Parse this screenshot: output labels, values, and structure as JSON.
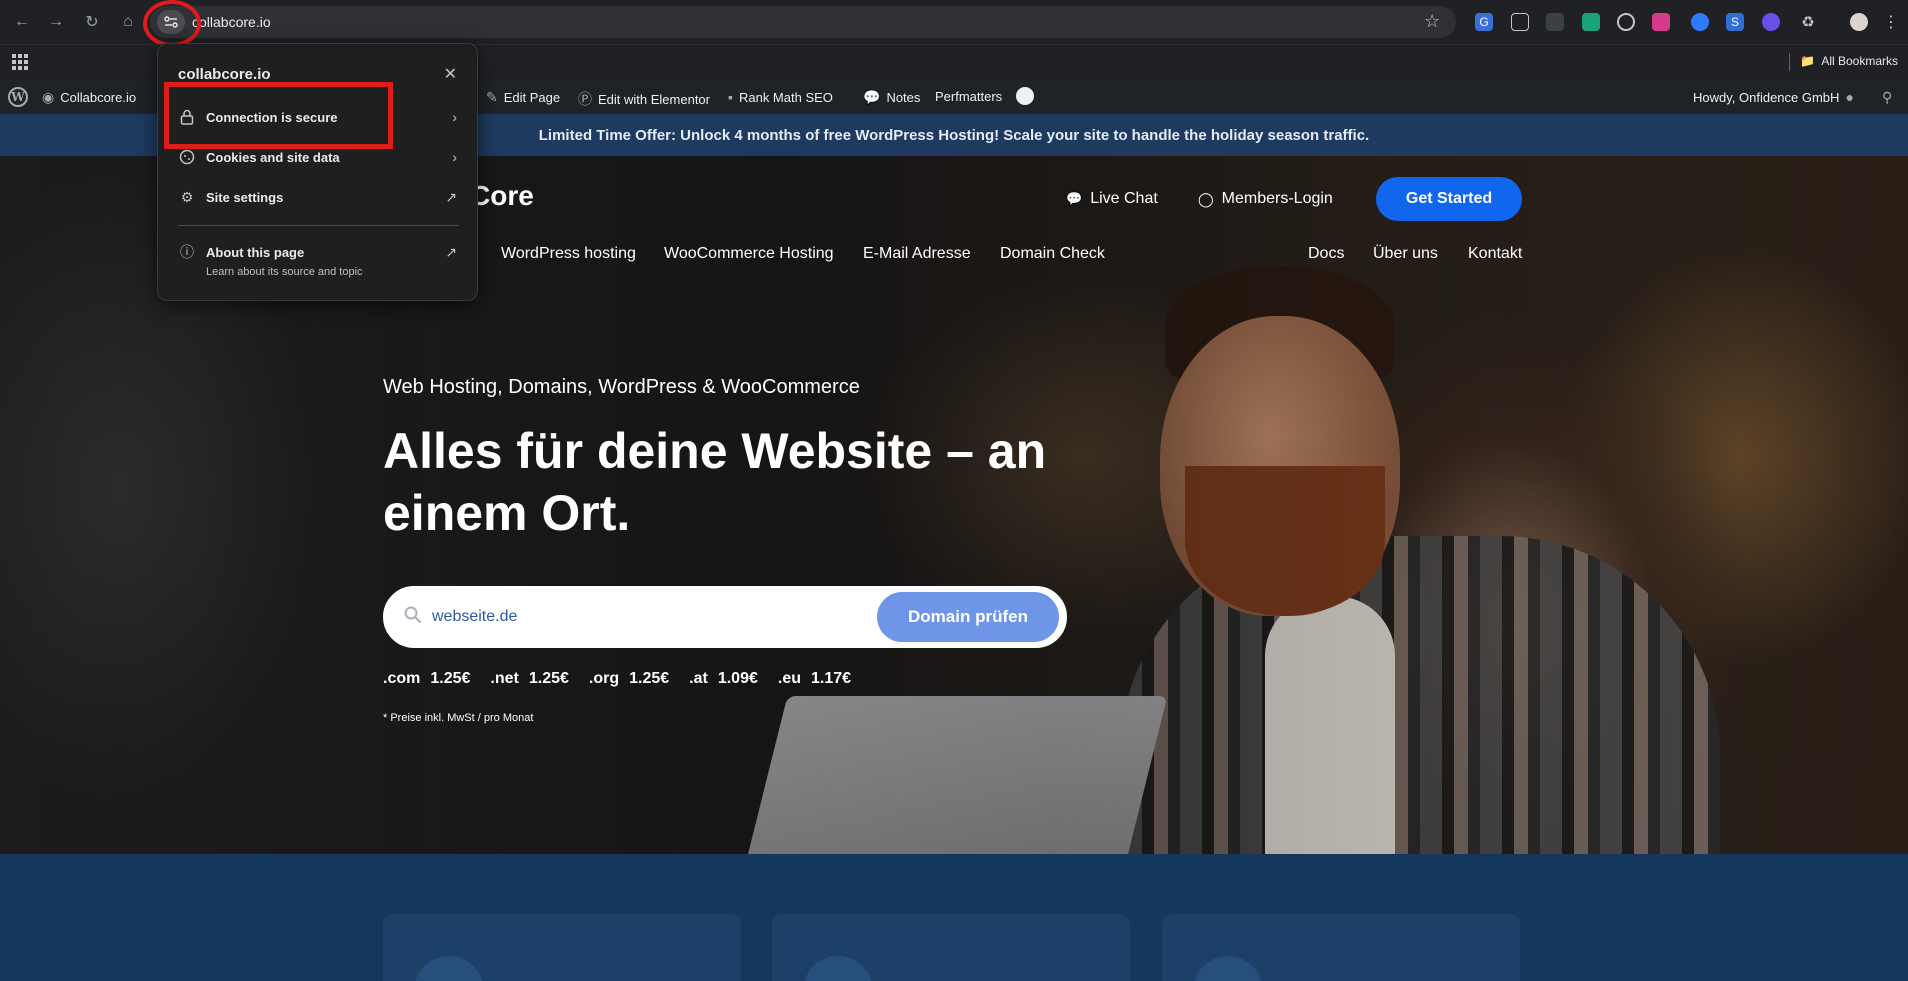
{
  "browser": {
    "url": "collabcore.io",
    "all_bookmarks_label": "All Bookmarks"
  },
  "wp_admin_bar": {
    "site_name": "Collabcore.io",
    "edit_page": "Edit Page",
    "edit_with_elementor": "Edit with Elementor",
    "rank_math": "Rank Math SEO",
    "notes": "Notes",
    "perfmatters": "Perfmatters",
    "howdy": "Howdy, Onfidence GmbH"
  },
  "offer_banner": "Limited Time Offer: Unlock 4 months of free WordPress Hosting! Scale your site to handle the holiday season traffic.",
  "header": {
    "logo_partial": "Core",
    "live_chat": "Live Chat",
    "members_login": "Members-Login",
    "get_started": "Get Started"
  },
  "nav": {
    "left": [
      "WordPress hosting",
      "WooCommerce Hosting",
      "E-Mail Adresse",
      "Domain Check"
    ],
    "right": [
      "Docs",
      "Über uns",
      "Kontakt"
    ]
  },
  "hero": {
    "subtitle": "Web Hosting, Domains, WordPress & WooCommerce",
    "title": "Alles für deine Website – an einem Ort.",
    "search_placeholder": "webseite.de",
    "domain_button": "Domain prüfen",
    "tlds": [
      {
        "ext": ".com",
        "price": "1.25€"
      },
      {
        "ext": ".net",
        "price": "1.25€"
      },
      {
        "ext": ".org",
        "price": "1.25€"
      },
      {
        "ext": ".at",
        "price": "1.09€"
      },
      {
        "ext": ".eu",
        "price": "1.17€"
      }
    ],
    "note": "* Preise inkl. MwSt / pro Monat"
  },
  "popup": {
    "title": "collabcore.io",
    "connection": "Connection is secure",
    "cookies": "Cookies and site data",
    "site_settings": "Site settings",
    "about": "About this page",
    "about_sub": "Learn about its source and topic"
  },
  "colors": {
    "accent_button": "#1166ee",
    "banner": "#1e3a5f",
    "highlight_red": "#e01b1b"
  }
}
